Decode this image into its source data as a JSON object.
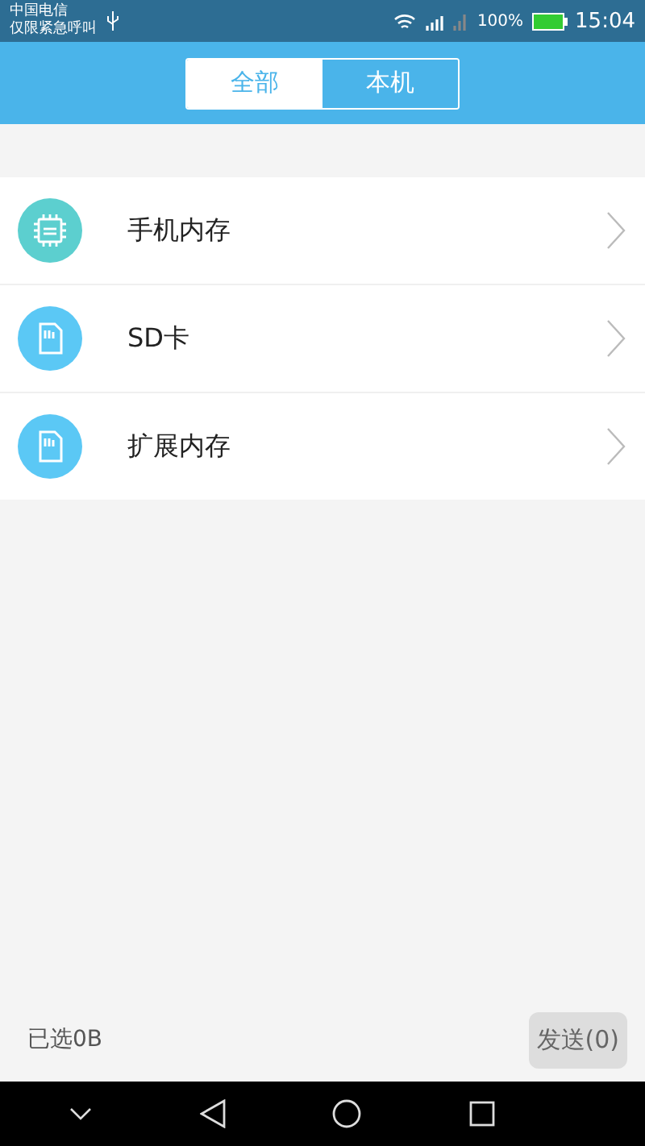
{
  "status_bar": {
    "carrier": "中国电信",
    "carrier_note": "仅限紧急呼叫",
    "battery_text": "100%",
    "time": "15:04"
  },
  "tabs": [
    {
      "label": "全部",
      "selected": true
    },
    {
      "label": "本机",
      "selected": false
    }
  ],
  "storage_items": [
    {
      "label": "手机内存",
      "kind": "chip"
    },
    {
      "label": "SD卡",
      "kind": "card"
    },
    {
      "label": "扩展内存",
      "kind": "card"
    }
  ],
  "footer": {
    "selected_size": "已选0B",
    "send_button": "发送(0)"
  }
}
